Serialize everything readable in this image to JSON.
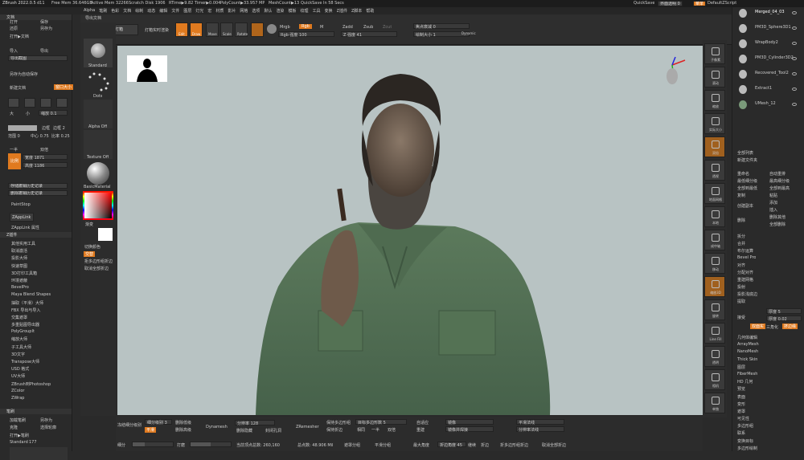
{
  "status": {
    "app": "ZBrush 2022.0.5",
    "doc": "d11",
    "free_mem": "Free Mem 36.646GB",
    "active_mem": "Active Mem 32266",
    "scratch": "Scratch Disk 1906",
    "rtime": "RTime▶9.82 Timer▶0.004",
    "polycount": "PolyCount▶33.957 MP",
    "meshcount": "MeshCount▶13",
    "quicksave_msg": "QuickSave In 58 Secs",
    "quicksave_btn": "QuickSave",
    "ui_transparency": "界面透明 0",
    "menu_btn": "菜单",
    "script": "DefaultZScript"
  },
  "menu": [
    "Alpha",
    "笔刷",
    "色彩",
    "文档",
    "绘制",
    "动态",
    "编辑",
    "文件",
    "图层",
    "灯光",
    "宏",
    "材质",
    "影片",
    "网格",
    "选项",
    "默认",
    "渲染",
    "模板",
    "纹理",
    "工具",
    "变换",
    "Z插件",
    "Z脚本",
    "帮助"
  ],
  "top": {
    "export": "导出文档",
    "home": "主页",
    "lightbox": "灯箱",
    "lightbox_preview": "灯箱实时渲染",
    "edit": "Edit",
    "draw": "Draw",
    "move": "Move",
    "scale": "Scale",
    "rotate": "Rotate",
    "mrgb": "Mrgb",
    "rgb": "Rgb",
    "m": "M",
    "zadd": "Zadd",
    "zsub": "Zsub",
    "zcut": "Zcut",
    "rgb_intensity": "Rgb 强度 100",
    "z_intensity": "Z 强度 41",
    "focal_shift": "焦点衰减 0",
    "draw_size": "绘制大小 1",
    "dynamic": "Dynamic"
  },
  "left_panel": {
    "doc_hdr": "文档",
    "open": "打开",
    "save": "保存",
    "revert": "还原",
    "saveas": "另存为",
    "open_doc": "打开▶文档",
    "import": "导入",
    "export": "导出",
    "export_screenshot": "导出截图",
    "saveas_autosave": "另存为自动保存",
    "new_doc": "新建文档",
    "window_size": "窗口大小",
    "zoom": "缩放 0.1",
    "big": "大",
    "small": "小",
    "border": "边框",
    "border2": "边框 2",
    "range": "范围 0",
    "center": "中心 0.75",
    "ratio": "比率 0.25",
    "one": "一半",
    "double": "双倍",
    "scale": "比例",
    "width": "宽度 1871",
    "height": "高度 1186",
    "store_history": "存储撤销历史记录",
    "delete_history": "删除撤销历史记录",
    "paintstop": "PaintStop",
    "zapplink": "ZAppLink",
    "zapplink_attr": "ZAppLink 属性",
    "zplugin_hdr": "Z插件",
    "plugins": [
      "其他实用工具",
      "取消激活",
      "投影大师",
      "快速草图",
      "3D打印工具箱",
      "环境遮蔽",
      "BevelPro",
      "Maya Blend Shapes",
      "抽取（平滑）大师",
      "FBX 导出与导入",
      "交集遮罩",
      "多重贴图导出器",
      "PolyGroupIt",
      "缩放大师",
      "子工具大师",
      "3D文字",
      "Transpose大师",
      "USD 格式",
      "UV大师",
      "ZBrush到Photoshop",
      "ZColor",
      "ZWrap"
    ],
    "brush_hdr": "笔刷",
    "load_brush": "加载笔刷",
    "save_as": "另存为",
    "clone": "克隆",
    "select_brush": "选择轮廓",
    "open_brush": "打开▶笔刷",
    "standard": "Standard",
    "standard_num": "177"
  },
  "shelf": {
    "standard": "Standard",
    "dots": "Dots",
    "alpha_off": "Alpha Off",
    "texture_off": "Texture Off",
    "basic_material": "BasicMaterial",
    "gradient": "渐变",
    "switch_color": "切换颜色",
    "alternate": "交替",
    "restore_masks": "拒多边形组折边",
    "cancel_folds": "取消全部折边"
  },
  "rightshelf": [
    "子像素",
    "滚动",
    "缩放",
    "实际大小",
    "双倍",
    "透视",
    "地面网格",
    "本地",
    "成中轴",
    "移动",
    "缩放3D",
    "旋转",
    "Line Fill",
    "透明",
    "相机",
    "单独"
  ],
  "subtools": [
    {
      "name": "Merged_04_03",
      "visible": true
    },
    {
      "name": "PM3D_Sphere3D1",
      "visible": true
    },
    {
      "name": "WrapBody2",
      "visible": true
    },
    {
      "name": "PM3D_Cylinder3D2",
      "visible": true
    },
    {
      "name": "Recovered_Tool2",
      "visible": true
    },
    {
      "name": "Extract1",
      "visible": true
    },
    {
      "name": "UMesh_12",
      "visible": true
    }
  ],
  "right_panel": {
    "list_all": "全部列表",
    "new_folder": "新建文件夹",
    "rename": "重命名",
    "auto_reorder": "自动重排",
    "all_low": "最低细分级",
    "all_high": "最高细分级",
    "all_to_low": "全部到最低",
    "all_to_high": "全部到最高",
    "copy": "复制",
    "paste": "粘贴",
    "create_copy": "创建副本",
    "add": "添加",
    "insert": "插入",
    "delete": "删除",
    "del_other": "删除其他",
    "del_all": "全部删除",
    "split": "拆分",
    "merge": "合并",
    "boolean": "布尔运算",
    "bevel": "Bevel Pro",
    "align": "对齐",
    "distribute": "分配对齐",
    "remesh": "重建网格",
    "project": "投射",
    "project_shadow": "投影浅底边",
    "extract": "提取",
    "thickness": "厚度 5",
    "depth": "厚度 0.02",
    "accept": "接受",
    "double": "双面实",
    "tcorner": "三角化",
    "edge_loop": "挤边缘",
    "accept2": "接受",
    "sections": [
      "几何体编辑",
      "ArrayMesh",
      "NanoMesh",
      "Thick Skin",
      "图层",
      "FiberMesh",
      "HD 几何",
      "预览",
      "表面",
      "变形",
      "遮罩",
      "可见性",
      "多边形组",
      "联系",
      "变换目标",
      "多边形绘制"
    ]
  },
  "bottom": {
    "subdiv_level": "细分级别 3",
    "del_lower": "删除低级",
    "del_higher": "删除高级",
    "subdivide": "细分网格",
    "smooth": "平滑",
    "dynamesh": "Dynamesh",
    "resolution": "分辨率 128",
    "del_hidden": "删除隐藏",
    "close_holes": "封闭孔洞",
    "zremesher": "ZRemesher",
    "keep_groups": "保持多边形组",
    "keep_creases": "保持折边",
    "target_poly": "目标多边形数 5",
    "same": "相同",
    "half": "一半",
    "double": "双倍",
    "adaptive": "自适应",
    "mirror": "镜像",
    "mirror_weld": "镜像并焊接",
    "smooth_normals": "平滑法线",
    "rebuild": "重建",
    "dynamic_normals": "分辨率法线",
    "points": "当前顶点总数: 260,160",
    "total_points": "总点数: 48.906 Mil",
    "masked": "遮罩分组",
    "smooth_group": "平滑分组",
    "crease_angle": "折边角度 45",
    "cont": "继续",
    "crease": "折边",
    "crease_pg": "折多边形组折边",
    "uncrease_all": "取消全部折边",
    "freeze": "冻结细分级别",
    "subdiv_small": "细分",
    "size_label": "最大角度",
    "polish": "打磨"
  }
}
